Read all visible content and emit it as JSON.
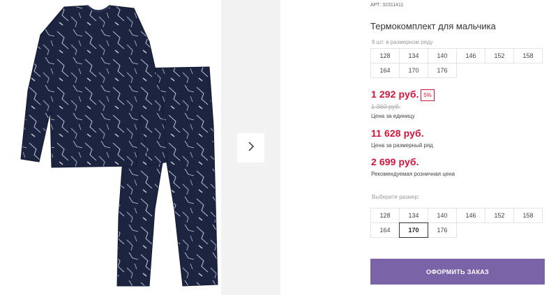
{
  "product": {
    "article_label": "АРТ:",
    "article_number": "32311411",
    "title": "Термокомплект для мальчика",
    "image_alt": "Термокомплект для мальчика"
  },
  "size_range": {
    "caption": "9 шт. в размерном ряду",
    "sizes": [
      "128",
      "134",
      "140",
      "146",
      "152",
      "158",
      "164",
      "170",
      "176"
    ]
  },
  "pricing": {
    "unit_price": "1 292 руб.",
    "discount_badge": "5%",
    "old_price": "1 360 руб.",
    "unit_price_note": "Цена за единицу",
    "range_price": "11 628 руб.",
    "range_price_note": "Цена за размерный ряд",
    "retail_price": "2 699 руб.",
    "retail_price_note": "Рекомендуемая розничная цена"
  },
  "size_picker": {
    "caption": "Выберите размер:",
    "sizes": [
      "128",
      "134",
      "140",
      "146",
      "152",
      "158",
      "164",
      "170",
      "176"
    ],
    "selected": "170"
  },
  "actions": {
    "order_button": "ОФОРМИТЬ ЗАКАЗ"
  },
  "icons": {
    "next": "chevron-right-icon"
  },
  "colors": {
    "accent_red": "#d2143a",
    "button_purple": "#7a63a6",
    "garment_navy": "#1c2440"
  }
}
